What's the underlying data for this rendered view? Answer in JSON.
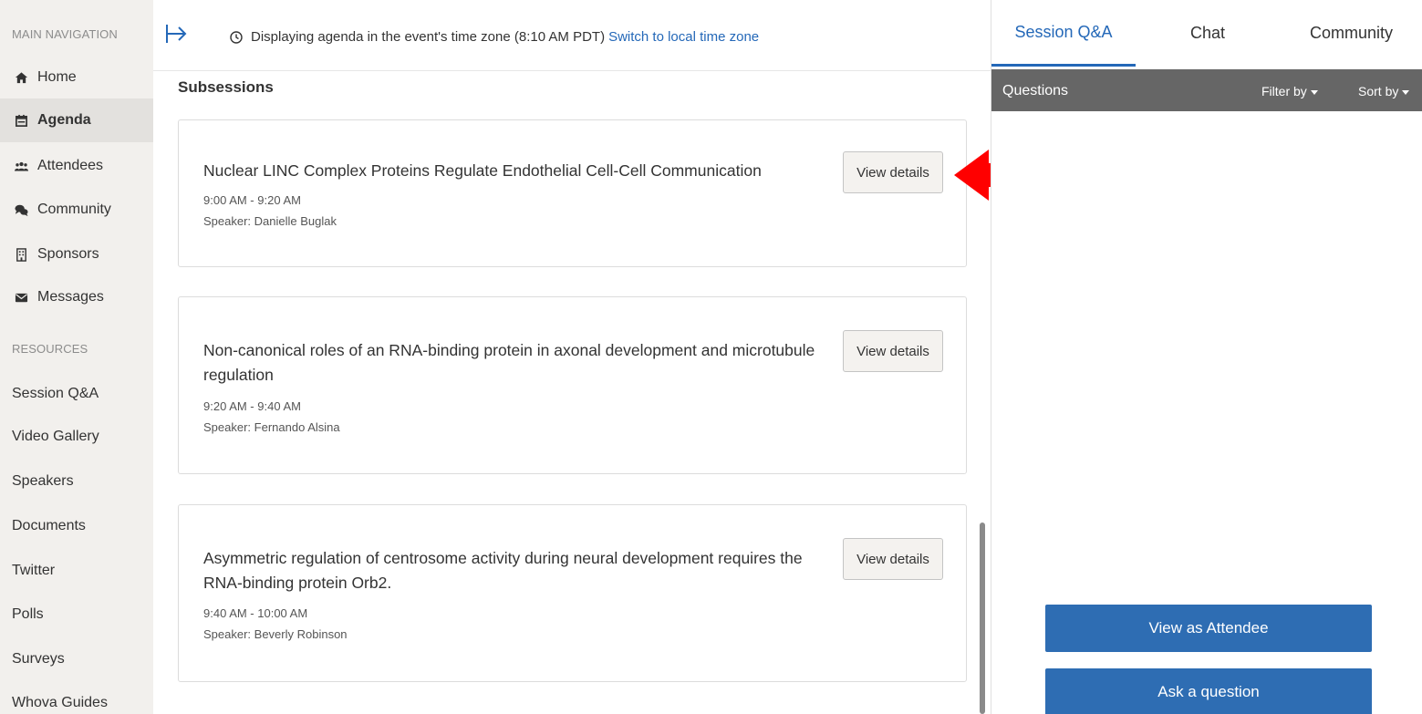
{
  "sidebar": {
    "main_nav_title": "MAIN NAVIGATION",
    "items": [
      {
        "label": "Home",
        "icon": "home-icon"
      },
      {
        "label": "Agenda",
        "icon": "calendar-icon"
      },
      {
        "label": "Attendees",
        "icon": "users-icon"
      },
      {
        "label": "Community",
        "icon": "chat-bubbles-icon"
      },
      {
        "label": "Sponsors",
        "icon": "building-icon"
      },
      {
        "label": "Messages",
        "icon": "envelope-icon"
      }
    ],
    "resources_title": "RESOURCES",
    "resources": [
      {
        "label": "Session Q&A"
      },
      {
        "label": "Video Gallery"
      },
      {
        "label": "Speakers"
      },
      {
        "label": "Documents"
      },
      {
        "label": "Twitter"
      },
      {
        "label": "Polls"
      },
      {
        "label": "Surveys"
      },
      {
        "label": "Whova Guides"
      }
    ]
  },
  "topbar": {
    "tz_text": "Displaying agenda in the event's time zone (8:10 AM PDT)",
    "tz_link": "Switch to local time zone"
  },
  "main": {
    "subsessions_title": "Subsessions",
    "view_details_label": "View details",
    "cards": [
      {
        "title": "Nuclear LINC Complex Proteins Regulate Endothelial Cell-Cell Communication",
        "time": "9:00 AM - 9:20 AM",
        "speaker": "Speaker: Danielle Buglak"
      },
      {
        "title": "Non-canonical roles of an RNA-binding protein in axonal development and microtubule regulation",
        "time": "9:20 AM - 9:40 AM",
        "speaker": "Speaker: Fernando Alsina"
      },
      {
        "title": "Asymmetric regulation of centrosome activity during neural development requires the RNA-binding protein Orb2.",
        "time": "9:40 AM - 10:00 AM",
        "speaker": "Speaker: Beverly Robinson"
      }
    ]
  },
  "right_panel": {
    "tabs": [
      {
        "label": "Session Q&A"
      },
      {
        "label": "Chat"
      },
      {
        "label": "Community"
      }
    ],
    "questions_label": "Questions",
    "filter_label": "Filter by",
    "sort_label": "Sort by",
    "view_as_attendee": "View as Attendee",
    "ask_question": "Ask a question"
  },
  "colors": {
    "accent": "#2468b8",
    "button_blue": "#2e6db3",
    "sidebar_bg": "#f2f0ed",
    "annotation_arrow": "#ff0000"
  }
}
